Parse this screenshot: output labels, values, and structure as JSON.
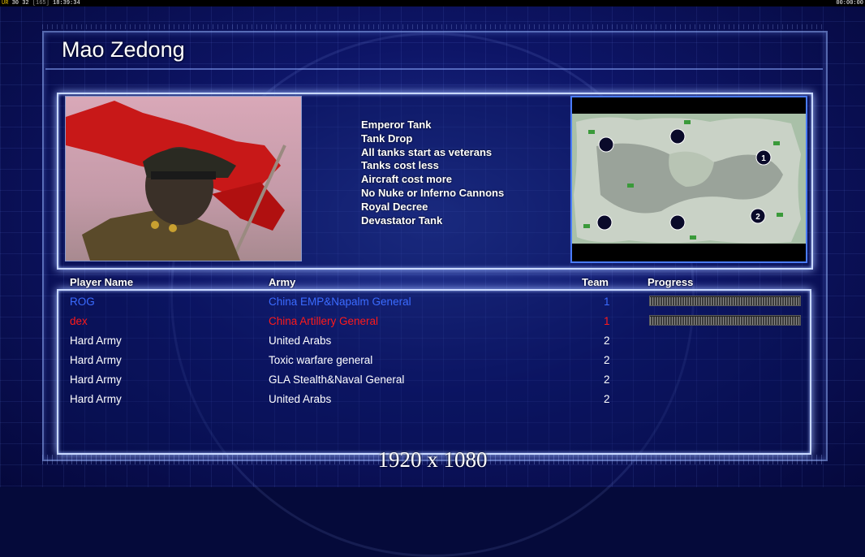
{
  "hud": {
    "left_prefix": "UR",
    "left_values": "30 32",
    "left_bracket": "[165]",
    "left_time": "18:39:34",
    "right_time": "00:00:00"
  },
  "general": {
    "name": "Mao Zedong",
    "bonuses": [
      "Emperor Tank",
      "Tank Drop",
      "All tanks start as veterans",
      "Tanks cost less",
      "Aircraft cost more",
      "No Nuke or Inferno Cannons",
      "Royal Decree",
      "Devastator Tank"
    ]
  },
  "table": {
    "headers": {
      "name": "Player Name",
      "army": "Army",
      "team": "Team",
      "progress": "Progress"
    },
    "rows": [
      {
        "name": "ROG",
        "army": "China EMP&Napalm General",
        "team": "1",
        "color": "#3b6bff",
        "progress": 1.0
      },
      {
        "name": "dex",
        "army": "China Artillery General",
        "team": "1",
        "color": "#ff1a1a",
        "progress": 1.0
      },
      {
        "name": "Hard Army",
        "army": "United Arabs",
        "team": "2",
        "color": "#ffffff"
      },
      {
        "name": "Hard Army",
        "army": "Toxic warfare general",
        "team": "2",
        "color": "#ffffff"
      },
      {
        "name": "Hard Army",
        "army": "GLA Stealth&Naval General",
        "team": "2",
        "color": "#ffffff"
      },
      {
        "name": "Hard Army",
        "army": "United Arabs",
        "team": "2",
        "color": "#ffffff"
      }
    ]
  },
  "minimap": {
    "markers": [
      "1",
      "2"
    ]
  },
  "resolution_label": "1920 x 1080"
}
